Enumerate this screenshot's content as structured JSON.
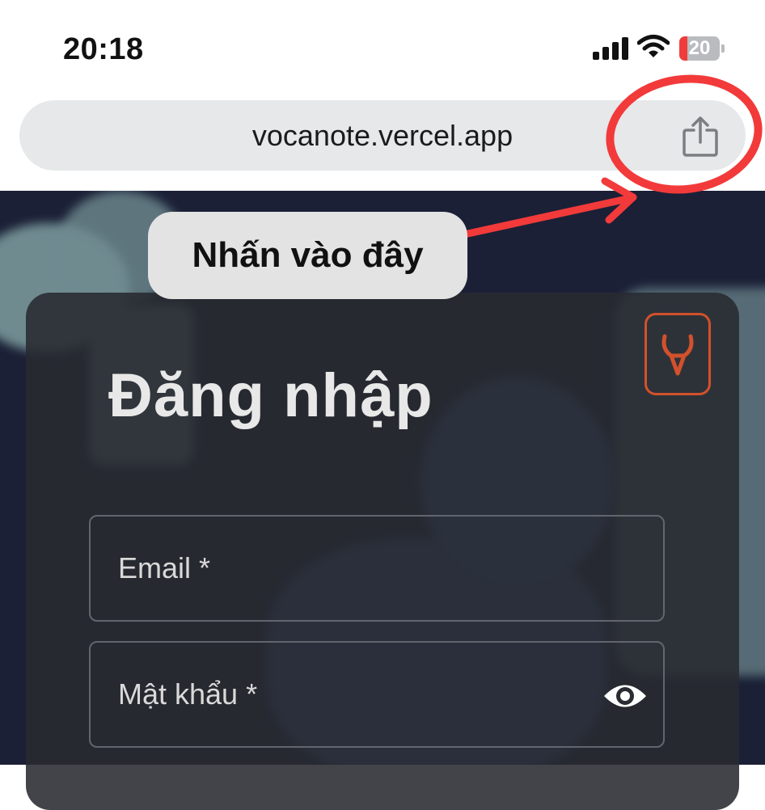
{
  "status_bar": {
    "time": "20:18",
    "battery_level": "20",
    "battery_fraction": 0.2,
    "icons": [
      "cellular-signal-icon",
      "wifi-icon",
      "battery-icon"
    ]
  },
  "browser": {
    "url": "vocanote.vercel.app",
    "share_icon": "share-icon"
  },
  "annotation": {
    "text": "Nhấn vào đây",
    "color": "#f23a3a"
  },
  "login": {
    "title": "Đăng nhập",
    "email_label": "Email *",
    "password_label": "Mật khẩu *",
    "toggle_icon": "eye-icon",
    "logo_color": "#d2512c"
  }
}
